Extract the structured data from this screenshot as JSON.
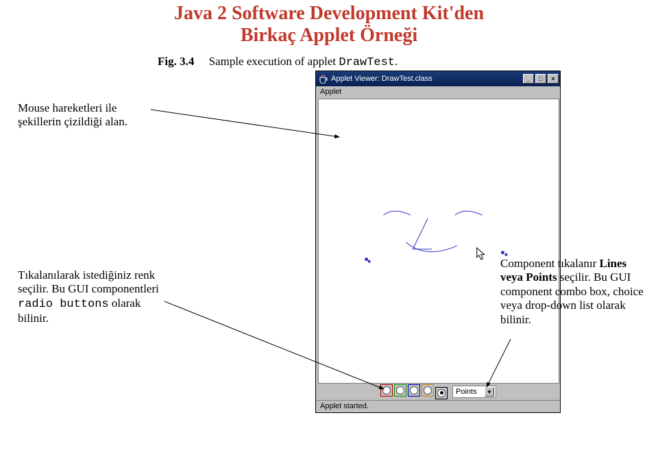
{
  "title": {
    "line1": "Java 2 Software Development Kit'den",
    "line2": "Birkaç Applet Örneği"
  },
  "figure": {
    "label": "Fig. 3.4",
    "caption_prefix": "Sample execution of applet ",
    "applet_name": "DrawTest",
    "caption_suffix": "."
  },
  "window": {
    "title": "Applet Viewer: DrawTest.class",
    "menu": "Applet",
    "status": "Applet started."
  },
  "controls": {
    "dropdown_value": "Points",
    "radio_colors": [
      "#c00000",
      "#00a000",
      "#0000c0",
      "#d08000",
      "#000000"
    ],
    "selected_index": 4
  },
  "notes": {
    "n1": "Mouse hareketleri ile şekillerin çizildiği alan.",
    "n2_a": "Tıkalanılarak istediğiniz renk seçilir. Bu  GUI componentleri ",
    "n2_code": "radio buttons",
    "n2_b": " olarak bilinir.",
    "n3_a": "Component tıkalanır ",
    "n3_bold": "Lines veya Points",
    "n3_b": " seçilir. Bu  GUI component combo box, choice veya drop-down list olarak bilinir."
  }
}
